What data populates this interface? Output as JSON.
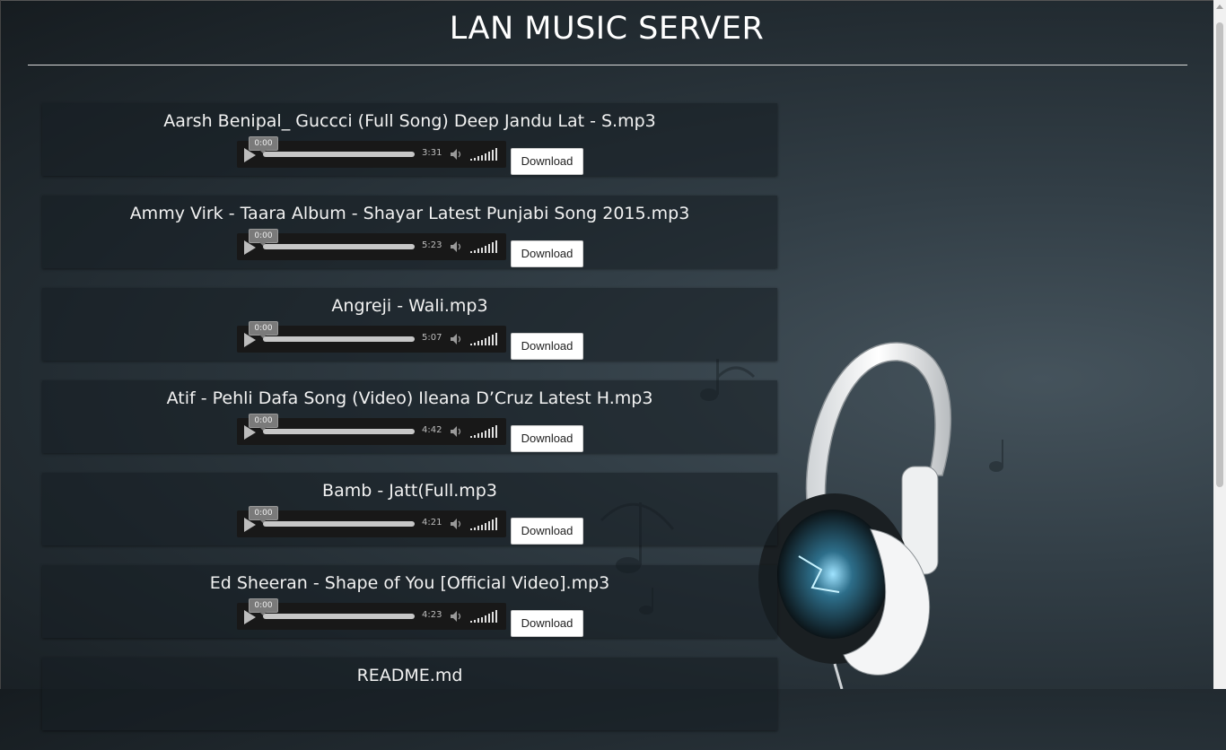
{
  "page": {
    "title": "LAN MUSIC SERVER"
  },
  "download_label": "Download",
  "songs": [
    {
      "title": "Aarsh Benipal_ Guccci (Full Song) Deep Jandu Lat - S.mp3",
      "current_time": "0:00",
      "duration": "3:31"
    },
    {
      "title": "Ammy Virk - Taara Album - Shayar Latest Punjabi Song 2015.mp3",
      "current_time": "0:00",
      "duration": "5:23"
    },
    {
      "title": "Angreji - Wali.mp3",
      "current_time": "0:00",
      "duration": "5:07"
    },
    {
      "title": "Atif - Pehli Dafa Song (Video) Ileana D’Cruz Latest H.mp3",
      "current_time": "0:00",
      "duration": "4:42"
    },
    {
      "title": "Bamb - Jatt(Full.mp3",
      "current_time": "0:00",
      "duration": "4:21"
    },
    {
      "title": "Ed Sheeran - Shape of You [Official Video].mp3",
      "current_time": "0:00",
      "duration": "4:23"
    },
    {
      "title": "README.md",
      "current_time": "",
      "duration": ""
    }
  ],
  "icons": {
    "play": "play-icon",
    "mute": "speaker-icon",
    "volume": "volume-bars-icon",
    "background": "headphones-icon"
  },
  "colors": {
    "background": "#222b31",
    "title_text": "#ffffff",
    "button_bg": "#ffffff",
    "player_bg": "#181818"
  }
}
